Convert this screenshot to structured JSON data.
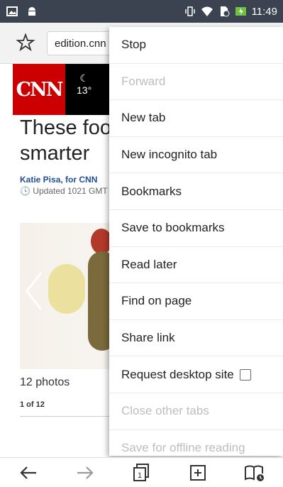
{
  "status_bar": {
    "time": "11:49"
  },
  "toolbar": {
    "url": "edition.cnn"
  },
  "page": {
    "logo": "CNN",
    "weather_temp": "13°",
    "headline_line1": "These foo",
    "headline_line2": "smarter",
    "byline_author": "Katie Pisa,",
    "byline_rest": "for CNN",
    "updated": "Updated 1021 GMT",
    "photos_count": "12 photos",
    "page_of": "1 of 12"
  },
  "menu": {
    "items": [
      {
        "label": "Stop",
        "disabled": false
      },
      {
        "label": "Forward",
        "disabled": true
      },
      {
        "label": "New tab",
        "disabled": false
      },
      {
        "label": "New incognito tab",
        "disabled": false
      },
      {
        "label": "Bookmarks",
        "disabled": false
      },
      {
        "label": "Save to bookmarks",
        "disabled": false
      },
      {
        "label": "Read later",
        "disabled": false
      },
      {
        "label": "Find on page",
        "disabled": false
      },
      {
        "label": "Share link",
        "disabled": false
      },
      {
        "label": "Request desktop site",
        "disabled": false
      },
      {
        "label": "Close other tabs",
        "disabled": true
      },
      {
        "label": "Save for offline reading",
        "disabled": true
      }
    ]
  },
  "bottom_nav": {
    "tab_count": "1",
    "icons": [
      "back-arrow-icon",
      "forward-arrow-icon",
      "tabs-icon",
      "new-tab-icon",
      "reading-list-icon"
    ]
  },
  "colors": {
    "status_bar": "#3b4250",
    "cnn_red": "#cc0000",
    "disabled_text": "#bdbdbd"
  }
}
